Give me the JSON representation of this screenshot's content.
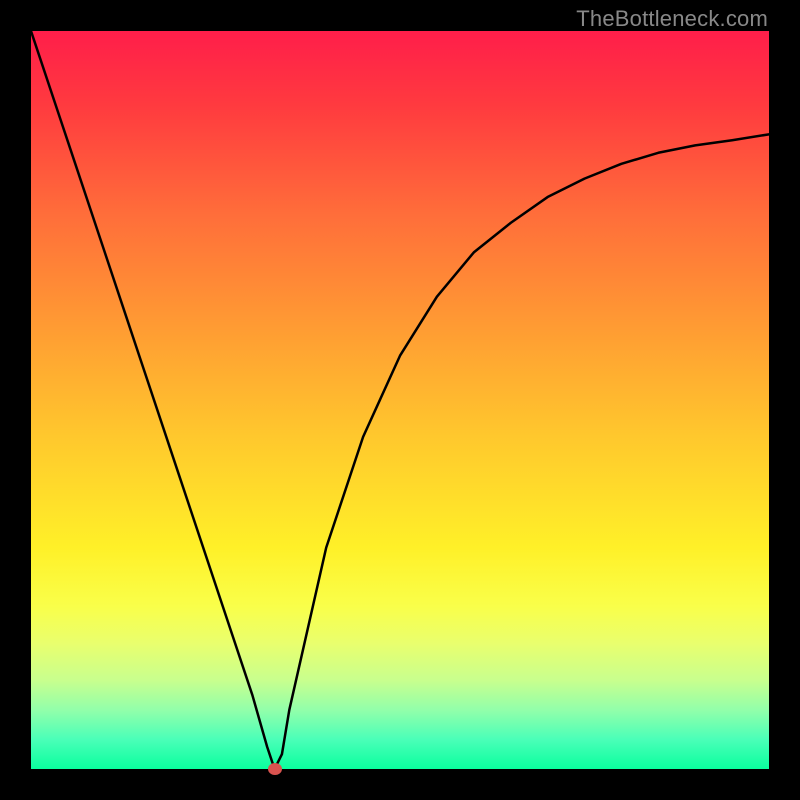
{
  "watermark": "TheBottleneck.com",
  "chart_data": {
    "type": "line",
    "title": "",
    "xlabel": "",
    "ylabel": "",
    "xlim": [
      0,
      100
    ],
    "ylim": [
      0,
      100
    ],
    "grid": false,
    "legend": false,
    "series": [
      {
        "name": "curve",
        "x": [
          0,
          5,
          10,
          15,
          20,
          25,
          30,
          32,
          33,
          34,
          35,
          40,
          45,
          50,
          55,
          60,
          65,
          70,
          75,
          80,
          85,
          90,
          95,
          100
        ],
        "y": [
          100,
          85,
          70,
          55,
          40,
          25,
          10,
          3,
          0,
          2,
          8,
          30,
          45,
          56,
          64,
          70,
          74,
          77.5,
          80,
          82,
          83.5,
          84.5,
          85.2,
          86
        ]
      }
    ],
    "marker": {
      "x": 33,
      "y": 0,
      "color": "#d9534f"
    },
    "background_gradient": {
      "top": "#ff1e4a",
      "bottom": "#0aff9e"
    }
  }
}
